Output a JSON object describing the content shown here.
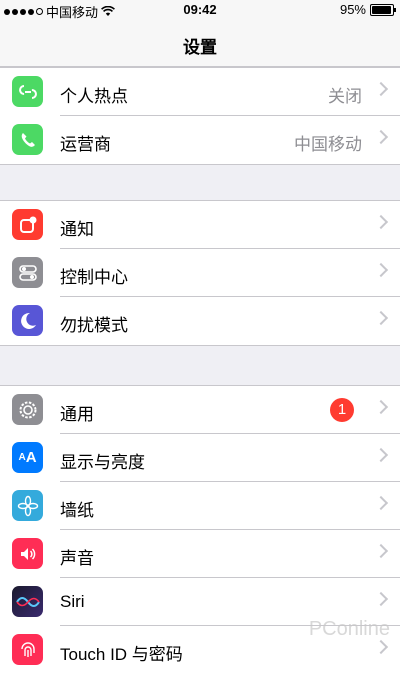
{
  "status_bar": {
    "carrier": "中国移动",
    "time": "09:42",
    "battery_percent": "95%",
    "battery_level": 0.95
  },
  "nav": {
    "title": "设置"
  },
  "groups": [
    {
      "rows": [
        {
          "label": "个人热点",
          "value": "关闭",
          "icon": "hotspot-icon",
          "color": "#4cd964"
        },
        {
          "label": "运营商",
          "value": "中国移动",
          "icon": "phone-icon",
          "color": "#4cd964"
        }
      ]
    },
    {
      "rows": [
        {
          "label": "通知",
          "icon": "notification-icon",
          "color": "#ff3b30"
        },
        {
          "label": "控制中心",
          "icon": "control-center-icon",
          "color": "#8e8e93"
        },
        {
          "label": "勿扰模式",
          "icon": "moon-icon",
          "color": "#5856d6"
        }
      ]
    },
    {
      "rows": [
        {
          "label": "通用",
          "badge": "1",
          "icon": "gear-icon",
          "color": "#8e8e93"
        },
        {
          "label": "显示与亮度",
          "icon": "text-size-icon",
          "color": "#007aff"
        },
        {
          "label": "墙纸",
          "icon": "flower-icon",
          "color": "#34aadc"
        },
        {
          "label": "声音",
          "icon": "speaker-icon",
          "color": "#ff2d55"
        },
        {
          "label": "Siri",
          "icon": "siri-icon",
          "color": "#1a1a2e"
        },
        {
          "label": "Touch ID 与密码",
          "icon": "fingerprint-icon",
          "color": "#ff2d55"
        }
      ]
    }
  ],
  "watermark": "PConline"
}
